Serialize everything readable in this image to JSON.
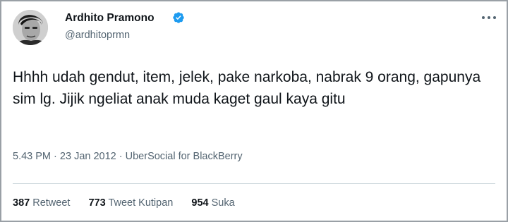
{
  "author": {
    "name": "Ardhito Pramono",
    "handle": "@ardhitoprmn",
    "verified_color": "#1d9bf0"
  },
  "icons": {
    "avatar": "avatar",
    "verified": "verified-badge-icon",
    "more": "more-options-icon"
  },
  "tweet": {
    "text": "Hhhh udah gendut, item, jelek, pake narkoba, nabrak 9 orang, gapunya sim lg. Jijik ngeliat anak muda kaget gaul kaya gitu",
    "time": "5.43 PM",
    "separator": "·",
    "date": "23 Jan 2012",
    "source": "UberSocial for BlackBerry"
  },
  "stats": {
    "retweets": {
      "count": "387",
      "label": "Retweet"
    },
    "quotes": {
      "count": "773",
      "label": "Tweet Kutipan"
    },
    "likes": {
      "count": "954",
      "label": "Suka"
    }
  }
}
